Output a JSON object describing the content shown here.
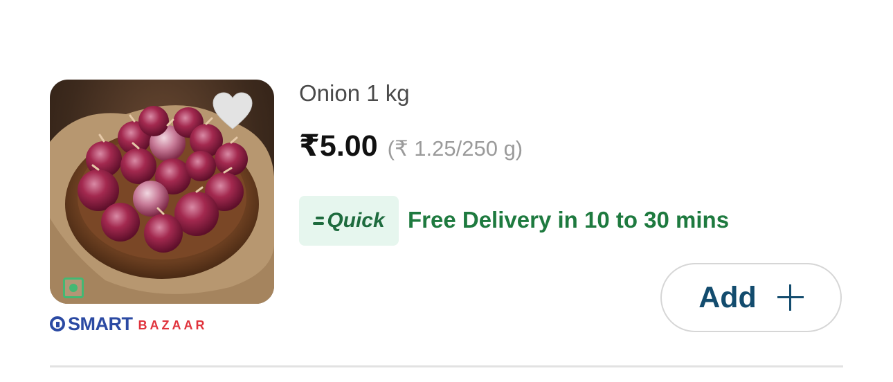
{
  "product": {
    "name": "Onion 1 kg",
    "price": "₹5.00",
    "unit_price": "(₹ 1.25/250 g)",
    "image_icon": "onion-basket-photo",
    "veg_indicator": "veg-mark-icon",
    "wishlist_icon": "heart-icon"
  },
  "brand": {
    "name_primary": "SMART",
    "name_secondary": "BAZAAR",
    "primary_color": "#2b4aa3",
    "secondary_color": "#e0333c"
  },
  "delivery": {
    "badge_label": "Quick",
    "text": "Free Delivery in 10 to 30 mins",
    "color": "#1e7a3f",
    "badge_bg": "#e6f6ee"
  },
  "actions": {
    "add_label": "Add",
    "add_icon": "plus-icon",
    "accent_color": "#134c6e"
  }
}
